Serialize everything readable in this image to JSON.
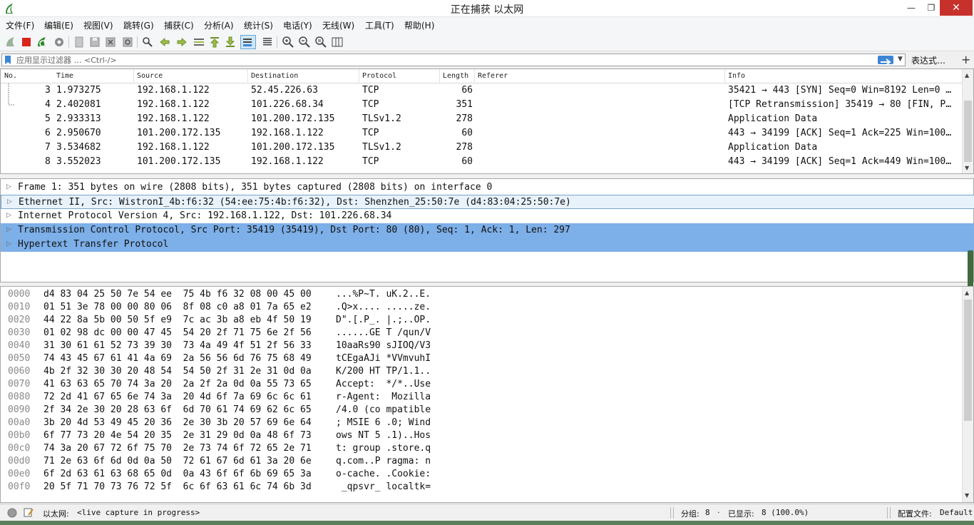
{
  "window": {
    "title": "正在捕获 以太网"
  },
  "menu": [
    "文件(F)",
    "编辑(E)",
    "视图(V)",
    "跳转(G)",
    "捕获(C)",
    "分析(A)",
    "统计(S)",
    "电话(Y)",
    "无线(W)",
    "工具(T)",
    "帮助(H)"
  ],
  "filter": {
    "placeholder": "应用显示过滤器 … <Ctrl-/>",
    "expression_label": "表达式…",
    "add_label": "+"
  },
  "packet_list": {
    "columns": [
      "No.",
      "Time",
      "Source",
      "Destination",
      "Protocol",
      "Length",
      "Referer",
      "Info"
    ],
    "rows": [
      {
        "no": "3",
        "time": "1.973275",
        "source": "192.168.1.122",
        "destination": "52.45.226.63",
        "protocol": "TCP",
        "length": "66",
        "referer": "",
        "info": "35421 → 443 [SYN] Seq=0 Win=8192 Len=0 …"
      },
      {
        "no": "4",
        "time": "2.402081",
        "source": "192.168.1.122",
        "destination": "101.226.68.34",
        "protocol": "TCP",
        "length": "351",
        "referer": "",
        "info": "[TCP Retransmission] 35419 → 80 [FIN, P…"
      },
      {
        "no": "5",
        "time": "2.933313",
        "source": "192.168.1.122",
        "destination": "101.200.172.135",
        "protocol": "TLSv1.2",
        "length": "278",
        "referer": "",
        "info": "Application Data"
      },
      {
        "no": "6",
        "time": "2.950670",
        "source": "101.200.172.135",
        "destination": "192.168.1.122",
        "protocol": "TCP",
        "length": "60",
        "referer": "",
        "info": "443 → 34199 [ACK] Seq=1 Ack=225 Win=100…"
      },
      {
        "no": "7",
        "time": "3.534682",
        "source": "192.168.1.122",
        "destination": "101.200.172.135",
        "protocol": "TLSv1.2",
        "length": "278",
        "referer": "",
        "info": "Application Data"
      },
      {
        "no": "8",
        "time": "3.552023",
        "source": "101.200.172.135",
        "destination": "192.168.1.122",
        "protocol": "TCP",
        "length": "60",
        "referer": "",
        "info": "443 → 34199 [ACK] Seq=1 Ack=449 Win=100…"
      }
    ]
  },
  "details": [
    "Frame 1: 351 bytes on wire (2808 bits), 351 bytes captured (2808 bits) on interface 0",
    "Ethernet II, Src: WistronI_4b:f6:32 (54:ee:75:4b:f6:32), Dst: Shenzhen_25:50:7e (d4:83:04:25:50:7e)",
    "Internet Protocol Version 4, Src: 192.168.1.122, Dst: 101.226.68.34",
    "Transmission Control Protocol, Src Port: 35419 (35419), Dst Port: 80 (80), Seq: 1, Ack: 1, Len: 297",
    "Hypertext Transfer Protocol"
  ],
  "bytes": [
    {
      "offset": "0000",
      "hex": "d4 83 04 25 50 7e 54 ee  75 4b f6 32 08 00 45 00",
      "ascii": "...%P~T. uK.2..E."
    },
    {
      "offset": "0010",
      "hex": "01 51 3e 78 00 00 80 06  8f 08 c0 a8 01 7a 65 e2",
      "ascii": ".Q>x.... .....ze."
    },
    {
      "offset": "0020",
      "hex": "44 22 8a 5b 00 50 5f e9  7c ac 3b a8 eb 4f 50 19",
      "ascii": "D\".[.P_. |.;..OP."
    },
    {
      "offset": "0030",
      "hex": "01 02 98 dc 00 00 47 45  54 20 2f 71 75 6e 2f 56",
      "ascii": "......GE T /qun/V"
    },
    {
      "offset": "0040",
      "hex": "31 30 61 61 52 73 39 30  73 4a 49 4f 51 2f 56 33",
      "ascii": "10aaRs90 sJIOQ/V3"
    },
    {
      "offset": "0050",
      "hex": "74 43 45 67 61 41 4a 69  2a 56 56 6d 76 75 68 49",
      "ascii": "tCEgaAJi *VVmvuhI"
    },
    {
      "offset": "0060",
      "hex": "4b 2f 32 30 30 20 48 54  54 50 2f 31 2e 31 0d 0a",
      "ascii": "K/200 HT TP/1.1.."
    },
    {
      "offset": "0070",
      "hex": "41 63 63 65 70 74 3a 20  2a 2f 2a 0d 0a 55 73 65",
      "ascii": "Accept:  */*..Use"
    },
    {
      "offset": "0080",
      "hex": "72 2d 41 67 65 6e 74 3a  20 4d 6f 7a 69 6c 6c 61",
      "ascii": "r-Agent:  Mozilla"
    },
    {
      "offset": "0090",
      "hex": "2f 34 2e 30 20 28 63 6f  6d 70 61 74 69 62 6c 65",
      "ascii": "/4.0 (co mpatible"
    },
    {
      "offset": "00a0",
      "hex": "3b 20 4d 53 49 45 20 36  2e 30 3b 20 57 69 6e 64",
      "ascii": "; MSIE 6 .0; Wind"
    },
    {
      "offset": "00b0",
      "hex": "6f 77 73 20 4e 54 20 35  2e 31 29 0d 0a 48 6f 73",
      "ascii": "ows NT 5 .1)..Hos"
    },
    {
      "offset": "00c0",
      "hex": "74 3a 20 67 72 6f 75 70  2e 73 74 6f 72 65 2e 71",
      "ascii": "t: group .store.q"
    },
    {
      "offset": "00d0",
      "hex": "71 2e 63 6f 6d 0d 0a 50  72 61 67 6d 61 3a 20 6e",
      "ascii": "q.com..P ragma: n"
    },
    {
      "offset": "00e0",
      "hex": "6f 2d 63 61 63 68 65 0d  0a 43 6f 6f 6b 69 65 3a",
      "ascii": "o-cache. .Cookie:"
    },
    {
      "offset": "00f0",
      "hex": "20 5f 71 70 73 76 72 5f  6c 6f 63 61 6c 74 6b 3d",
      "ascii": " _qpsvr_ localtk="
    }
  ],
  "status": {
    "interface": "以太网:",
    "capture_state": "<live capture in progress>",
    "group_label": "分组:",
    "group_count": "8",
    "dot": "·",
    "displayed_label": "已显示:",
    "displayed_value": "8 (100.0%)",
    "profile_label": "配置文件:",
    "profile_value": "Default"
  }
}
